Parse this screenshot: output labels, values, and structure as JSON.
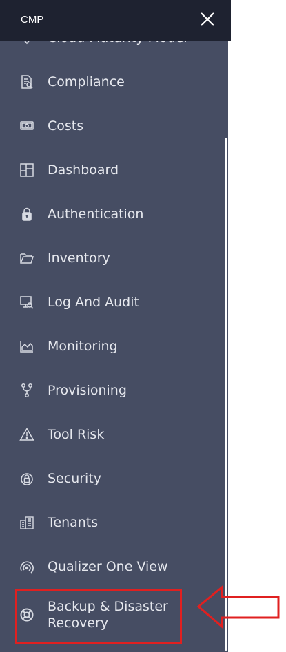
{
  "header": {
    "app_title": "CMP",
    "close_icon": "close-icon"
  },
  "menu": {
    "items": [
      {
        "label": "Cloud Maturity Model",
        "icon": "cloud-maturity-icon"
      },
      {
        "label": "Compliance",
        "icon": "compliance-icon"
      },
      {
        "label": "Costs",
        "icon": "costs-icon"
      },
      {
        "label": "Dashboard",
        "icon": "dashboard-icon"
      },
      {
        "label": "Authentication",
        "icon": "lock-icon"
      },
      {
        "label": "Inventory",
        "icon": "folder-open-icon"
      },
      {
        "label": "Log And Audit",
        "icon": "log-audit-icon"
      },
      {
        "label": "Monitoring",
        "icon": "area-chart-icon"
      },
      {
        "label": "Provisioning",
        "icon": "fork-icon"
      },
      {
        "label": "Tool Risk",
        "icon": "warning-icon"
      },
      {
        "label": "Security",
        "icon": "security-icon"
      },
      {
        "label": "Tenants",
        "icon": "tenants-icon"
      },
      {
        "label": "Qualizer One View",
        "icon": "radar-icon"
      },
      {
        "label": "Backup & Disaster Recovery",
        "icon": "lifebuoy-icon"
      }
    ]
  },
  "annotation": {
    "highlight_color": "#e02020",
    "highlighted_item": "Backup & Disaster Recovery"
  },
  "colors": {
    "header_bg": "#1e2230",
    "drawer_bg": "#464d63",
    "text": "#e6e8ee",
    "icon": "#d8dbe3"
  }
}
